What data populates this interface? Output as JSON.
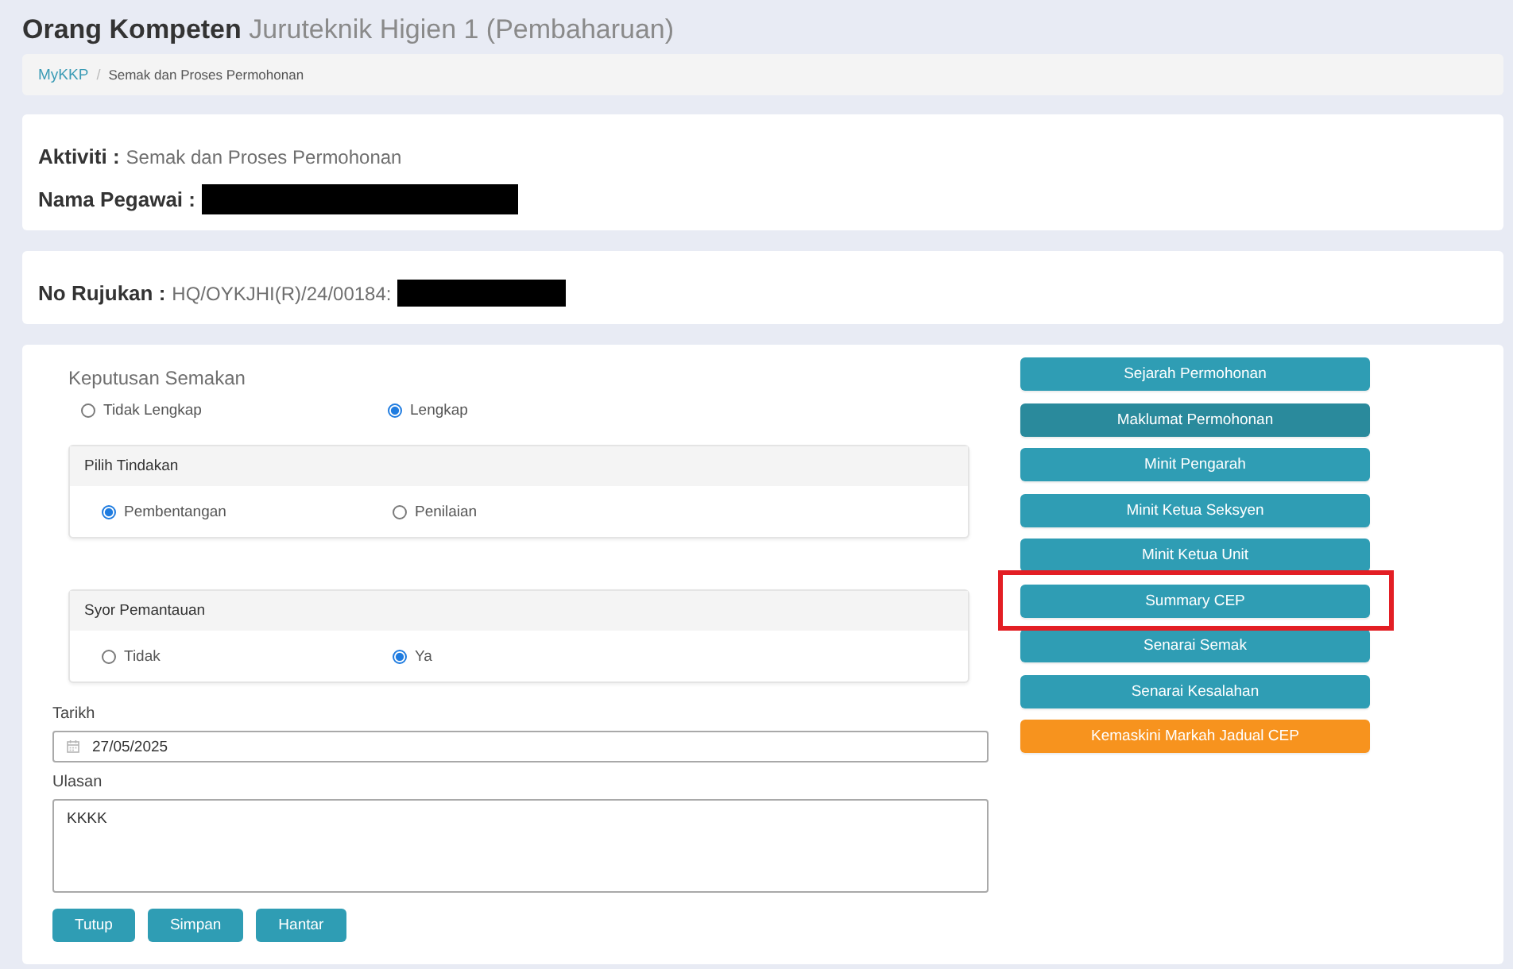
{
  "page_title": "**Orang Kompeten** Juruteknik Higien 1 (Pembaharuan)",
  "breadcrumb": {
    "separator": "/",
    "items": [
      {
        "label": "MyKKP",
        "kind": "link"
      },
      {
        "label": "Semak dan Proses Permohonan",
        "kind": "current"
      }
    ]
  },
  "info_cards": [
    {
      "fields": [
        {
          "label": "Aktiviti :",
          "value": "Semak dan Proses Permohonan"
        },
        {
          "label": "Nama Pegawai :",
          "redacted": true
        }
      ]
    },
    {
      "fields": [
        {
          "label": "No Rujukan :",
          "value": "HQ/OYKJHI(R)/24/00184:",
          "redacted": true
        }
      ]
    }
  ],
  "form": {
    "keputusan_semakan": {
      "label": "Keputusan Semakan",
      "options": [
        {
          "label": "Tidak Lengkap",
          "selected": false
        },
        {
          "label": "Lengkap",
          "selected": true
        }
      ]
    },
    "panels": [
      {
        "title": "Pilih Tindakan",
        "options": [
          {
            "label": "Pembentangan",
            "selected": true
          },
          {
            "label": "Penilaian",
            "selected": false
          }
        ]
      },
      {
        "title": "Syor Pemantauan",
        "options": [
          {
            "label": "Tidak",
            "selected": false
          },
          {
            "label": "Ya",
            "selected": true
          }
        ]
      }
    ],
    "tarikh": {
      "label": "Tarikh",
      "value": "27/05/2025"
    },
    "ulasan": {
      "label": "Ulasan",
      "value": "KKKK"
    },
    "buttons": [
      {
        "label": "Tutup"
      },
      {
        "label": "Simpan"
      },
      {
        "label": "Hantar"
      }
    ]
  },
  "side_buttons": [
    {
      "label": "Sejarah Permohonan",
      "kind": "info",
      "selected": false,
      "annotated": false
    },
    {
      "label": "Maklumat Permohonan",
      "kind": "info",
      "selected": true,
      "annotated": false
    },
    {
      "label": "Minit Pengarah",
      "kind": "info",
      "selected": false,
      "annotated": false
    },
    {
      "label": "Minit Ketua Seksyen",
      "kind": "info",
      "selected": false,
      "annotated": false
    },
    {
      "label": "Minit Ketua Unit",
      "kind": "info",
      "selected": false,
      "annotated": false
    },
    {
      "label": "Summary CEP",
      "kind": "info",
      "selected": false,
      "annotated": true
    },
    {
      "label": "Senarai Semak",
      "kind": "info",
      "selected": false,
      "annotated": false
    },
    {
      "label": "Senarai Kesalahan",
      "kind": "info",
      "selected": false,
      "annotated": false
    },
    {
      "label": "Kemaskini Markah Jadual CEP",
      "kind": "warning",
      "selected": false,
      "annotated": false
    }
  ]
}
